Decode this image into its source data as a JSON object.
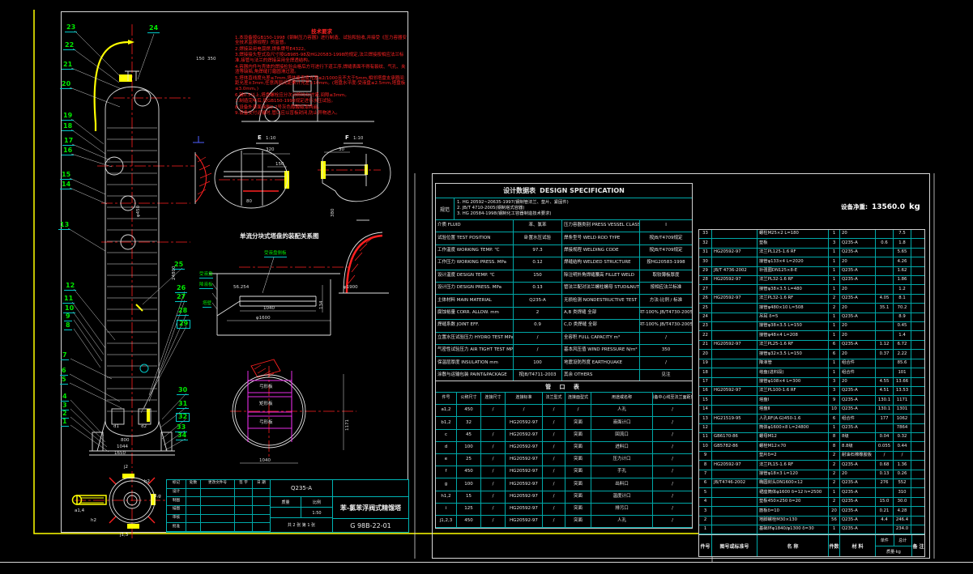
{
  "drawing": {
    "notes_title": "技术要求",
    "notes": [
      "1.本设备按GB150-1998《钢制压力容器》进行制造、试验和验收,并接受《压力容器安全技术监察规程》的监督。",
      "2.焊接采用电弧焊,焊条牌号E4322。",
      "3.焊接接头型式及尺寸按GB985-98及HG20583-1998的规定,法兰焊接按相应法兰标准,接管与法兰的焊接采用全焊透结构。",
      "4.容器内件与壳体的焊接检验合格后方可进行下道工序,焊缝表面不得有裂纹、气孔、夹渣等缺陷,角焊缝打磨圆滑过渡。",
      "5.塔体直线度允差≤7mm,塔体垂直度允差≤2/1000且不大于5mm,相邻塔盘支承圈间距允差±3mm,任意两层间距累计允差±10mm。(塔盘水平度:受液盘≤2.5mm,塔盘板≤3.0mm。)",
      "6.键0.5以上,塔盘螺栓应分次对称均匀拧紧,间隙≤3mm。",
      "7.制造完毕后,按GB150-1998规定进行水压试验。",
      "8.设备外表面涂刷2.2号灰色醇酸磁漆两遍。",
      "9.设备交付运输时,管口应以盲板封闭,防止异物进入。"
    ],
    "balloons": {
      "b1": "1",
      "b2": "2",
      "b3": "3",
      "b4": "4",
      "b5": "5",
      "b6": "6",
      "b7": "7",
      "b8": "8",
      "b9": "9",
      "b10": "10",
      "b11": "11",
      "b12": "12",
      "b13": "13",
      "b14": "14",
      "b15": "15",
      "b16": "16",
      "b17": "17",
      "b18": "18",
      "b19": "19",
      "b20": "20",
      "b21": "21",
      "b22": "22",
      "b23": "23",
      "b24": "24",
      "b25": "25",
      "b26": "26",
      "b27": "27",
      "b28": "28",
      "b29": "29",
      "b30": "30",
      "b31": "31",
      "b32": "32",
      "b33": "33",
      "b34": "34"
    },
    "dims": {
      "d150": "150",
      "d350": "350",
      "d320": "320",
      "d150b": "150",
      "d80": "80",
      "d30": "30",
      "d56": "56.254",
      "d1040a": "1040",
      "phi1600": "φ1600",
      "d134": "134",
      "d1040b": "1040",
      "d1171": "1171",
      "d800": "800",
      "d1044": "1044",
      "d1650": "1650",
      "phi1900": "φ1900",
      "phi450": "φ450",
      "d24800": "24800",
      "d380": "380",
      "dn1": "d1",
      "dn2": "d2"
    },
    "labels": {
      "tray_title": "单流分块式塔盘的装配关系图",
      "side_plate": "受液盘侧板",
      "pan": "受液盘",
      "downcomer": "降液板",
      "wall": "塔壁",
      "e": "E",
      "e_scale": "1:10",
      "f": "F",
      "f_scale": "1:10",
      "band1": "弓形板",
      "band2": "矩形板",
      "band3": "弓形板",
      "j2": "j2",
      "b2": "b2",
      "a14": "a1,4",
      "dg": "d,g",
      "h2": "h2",
      "j13": "j1,3",
      "h1": "h1"
    }
  },
  "spec": {
    "title_cn": "设计数据表",
    "title_en": "DESIGN SPECIFICATION",
    "codes_label": "规范",
    "codes": [
      "1. HG 20592~20635-1997(钢制管法兰、垫片、紧固件)",
      "2. JB/T 4710-2005(钢制塔式容器)",
      "3. HG 20584-1998(钢制化工容器制造技术要求)"
    ],
    "rows": [
      [
        "介质 FLUID",
        "苯、氯苯",
        "压力容器类别 PRESS VESSEL CLASS",
        "Ⅰ"
      ],
      [
        "试验位置 TEST POSITION",
        "卧置水压试验",
        "焊条型号 WELD ROD TYPE",
        "按JB/T4709规定"
      ],
      [
        "工作温度 WORKING TEMP. ℃",
        "97.3",
        "焊接规程 WELDING CODE",
        "按JB/T4709规定"
      ],
      [
        "工作压力 WORKING PRESS. MPa",
        "0.12",
        "焊缝结构 WELDED STRUCTURE",
        "按HG20583-1998"
      ],
      [
        "设计温度 DESIGN TEMP. ℃",
        "150",
        "除注明外角焊缝腰高 FILLET WELD",
        "取较薄板厚度"
      ],
      [
        "设计压力 DESIGN PRESS. MPa",
        "0.13",
        "管法兰配对法兰螺柱螺母 STUD&NUT",
        "按相应法兰标准"
      ],
      [
        "主体材料 MAIN MATERIAL",
        "Q235-A",
        "无损检测 NONDESTRUCTIVE TEST",
        "方法-比例 / 标准"
      ],
      [
        "腐蚀裕量 CORR. ALLOW. mm",
        "2",
        "A,B 类焊缝  全部",
        "RT-100% JB/T4730-2005"
      ],
      [
        "焊缝系数 JOINT EFF.",
        "0.9",
        "C,D 类焊缝  全部",
        "RT-100% JB/T4730-2005"
      ],
      [
        "立置水压试验压力 HYDRO TEST MPa",
        "/",
        "全容积 FULL CAPACITY m³",
        "/"
      ],
      [
        "气密性试验压力 AIR TIGHT TEST MPa",
        "/",
        "基本风压值 WIND PRESSURE N/m²",
        "350"
      ],
      [
        "保温层厚度 INSULATION mm",
        "100",
        "地震设防烈度 EARTHQUAKE",
        "/"
      ],
      [
        "涂敷与运输包装 PAINT&PACKAGE",
        "按JB/T4711-2003",
        "其余 OTHERS",
        "见注"
      ]
    ]
  },
  "nozzles": {
    "title": "管 口 表",
    "headers": [
      "件号",
      "公称尺寸",
      "连接尺寸",
      "连接标准",
      "法兰型式",
      "连接面型式",
      "用途或名称",
      "设备中心线至法兰面距离"
    ],
    "rows": [
      [
        "a1,2",
        "450",
        "/",
        "/",
        "/",
        "/",
        "人孔",
        "/"
      ],
      [
        "b1,2",
        "32",
        "",
        "HG20592-97",
        "/",
        "突面",
        "液面计口",
        "/"
      ],
      [
        "c",
        "45",
        "/",
        "HG20592-97",
        "/",
        "突面",
        "回流口",
        "/"
      ],
      [
        "d",
        "100",
        "/",
        "HG20592-97",
        "/",
        "突面",
        "进料口",
        "/"
      ],
      [
        "e",
        "25",
        "/",
        "HG20592-97",
        "/",
        "突面",
        "压力计口",
        "/"
      ],
      [
        "f",
        "450",
        "/",
        "HG20592-97",
        "/",
        "突面",
        "手孔",
        "/"
      ],
      [
        "g",
        "100",
        "/",
        "HG20592-97",
        "/",
        "突面",
        "出料口",
        "/"
      ],
      [
        "h1,2",
        "15",
        "/",
        "HG20592-97",
        "/",
        "突面",
        "温度计口",
        "/"
      ],
      [
        "i",
        "125",
        "/",
        "HG20592-97",
        "/",
        "突面",
        "排污口",
        "/"
      ],
      [
        "j1,2,3",
        "450",
        "/",
        "HG20592-97",
        "/",
        "突面",
        "人孔",
        "/"
      ]
    ]
  },
  "bom": {
    "rows": [
      [
        "33",
        "",
        "螺柱M25×2 L=180",
        "1",
        "20",
        "",
        "7.5",
        ""
      ],
      [
        "32",
        "",
        "垫板",
        "3",
        "Q235-A",
        "0.6",
        "1.8",
        ""
      ],
      [
        "31",
        "HG20592-97",
        "法兰PL125-1.6 RF",
        "1",
        "Q235-A",
        "",
        "5.65",
        ""
      ],
      [
        "30",
        "",
        "接管φ133×4 L=2020",
        "1",
        "20",
        "",
        "4.26",
        ""
      ],
      [
        "29",
        "JB/T 4736-2002",
        "补强圈DN125×8-E",
        "1",
        "Q235-A",
        "",
        "1.62",
        ""
      ],
      [
        "28",
        "HG20592-97",
        "法兰PL32-1.6 RF",
        "1",
        "Q235-A",
        "",
        "1.86",
        ""
      ],
      [
        "27",
        "",
        "接管φ38×3.5 L=480",
        "1",
        "20",
        "",
        "1.2",
        ""
      ],
      [
        "26",
        "HG20592-97",
        "法兰PL32-1.6 RF",
        "2",
        "Q235-A",
        "4.05",
        "8.1",
        ""
      ],
      [
        "25",
        "",
        "接管φ480×10 L=508",
        "2",
        "20",
        "35.1",
        "70.2",
        ""
      ],
      [
        "24",
        "",
        "吊耳 δ=5",
        "1",
        "Q235-A",
        "",
        "8.9",
        ""
      ],
      [
        "23",
        "",
        "接管φ38×3.5 L=150",
        "1",
        "20",
        "",
        "0.45",
        ""
      ],
      [
        "22",
        "",
        "接管φ48×4 L=208",
        "1",
        "20",
        "",
        "1.4",
        ""
      ],
      [
        "21",
        "HG20592-97",
        "法兰PL25-1.6 RF",
        "6",
        "Q235-A",
        "1.12",
        "6.72",
        ""
      ],
      [
        "20",
        "",
        "接管φ32×3.5 L=150",
        "6",
        "20",
        "0.37",
        "2.22",
        ""
      ],
      [
        "19",
        "",
        "降液管",
        "1",
        "组合件",
        "",
        "85.6",
        ""
      ],
      [
        "18",
        "",
        "塔盘(进料段)",
        "1",
        "组合件",
        "",
        "101",
        ""
      ],
      [
        "17",
        "",
        "接管φ108×4 L=300",
        "3",
        "20",
        "4.55",
        "13.66",
        ""
      ],
      [
        "16",
        "HG20592-97",
        "法兰PL100-1.6 RF",
        "3",
        "Q235-A",
        "4.51",
        "13.53",
        ""
      ],
      [
        "15",
        "",
        "塔盘Ⅰ",
        "9",
        "Q235-A",
        "130.1",
        "1171",
        ""
      ],
      [
        "14",
        "",
        "塔盘Ⅱ",
        "10",
        "Q235-A",
        "130.1",
        "1301",
        ""
      ],
      [
        "13",
        "HG21519-95",
        "人孔RF(A·G)450-1.6",
        "6",
        "组合件",
        "177",
        "1062",
        ""
      ],
      [
        "12",
        "",
        "筒体φ1600×8 L=24800",
        "1",
        "Q235-A",
        "",
        "7864",
        ""
      ],
      [
        "11",
        "GB6170-86",
        "螺母M12",
        "8",
        "8级",
        "0.04",
        "0.32",
        ""
      ],
      [
        "10",
        "GB5782-86",
        "螺栓M12×70",
        "8",
        "8.8级",
        "0.055",
        "0.44",
        ""
      ],
      [
        "9",
        "",
        "垫片δ=2",
        "2",
        "耐油石棉橡胶板",
        "/",
        "/",
        ""
      ],
      [
        "8",
        "HG20592-97",
        "法兰PL15-1.6 RF",
        "2",
        "Q235-A",
        "0.68",
        "1.36",
        ""
      ],
      [
        "7",
        "",
        "接管φ18×3 L=120",
        "2",
        "20",
        "0.13",
        "0.26",
        ""
      ],
      [
        "6",
        "JB/T4746-2002",
        "椭圆封头DN1600×12",
        "2",
        "Q235-A",
        "276",
        "552",
        ""
      ],
      [
        "5",
        "",
        "裙座筒体φ1600 δ=12 h=2500",
        "1",
        "Q235-A",
        "",
        "310",
        ""
      ],
      [
        "4",
        "",
        "垫板450×250 δ=20",
        "2",
        "Q235-A",
        "15.0",
        "30.0",
        ""
      ],
      [
        "3",
        "",
        "筋板δ=10",
        "20",
        "Q235-A",
        "0.21",
        "4.28",
        ""
      ],
      [
        "2",
        "",
        "地脚螺栓M30×130",
        "56",
        "Q235-A",
        "4.4",
        "246.4",
        ""
      ],
      [
        "1",
        "",
        "基础环φ1840/φ1300 δ=30",
        "1",
        "Q235-A",
        "",
        "234.0",
        ""
      ]
    ],
    "footer": {
      "item": "件号",
      "std": "图号或标准号",
      "name": "名  称",
      "qty": "件数",
      "mat": "材  料",
      "unit": "单件",
      "total": "总计",
      "mass": "质量·kg",
      "note": "备 注"
    }
  },
  "net_weight": {
    "label": "设备净重:",
    "value": "13560.0",
    "unit": "kg"
  },
  "title_block": {
    "material": "Q235-A",
    "title": "苯-氯苯浮阀式精馏塔",
    "drawing_no": "G 98B-22-01",
    "mass_label": "质量",
    "scale_label": "比例",
    "scale": "1:50",
    "sheet_info": "共 2 张  第 1 张",
    "rev_headers": [
      "标记",
      "处数",
      "更改文件号",
      "签 字",
      "日 期"
    ],
    "roles": [
      "设计",
      "制图",
      "描图",
      "审核",
      "批准"
    ]
  }
}
